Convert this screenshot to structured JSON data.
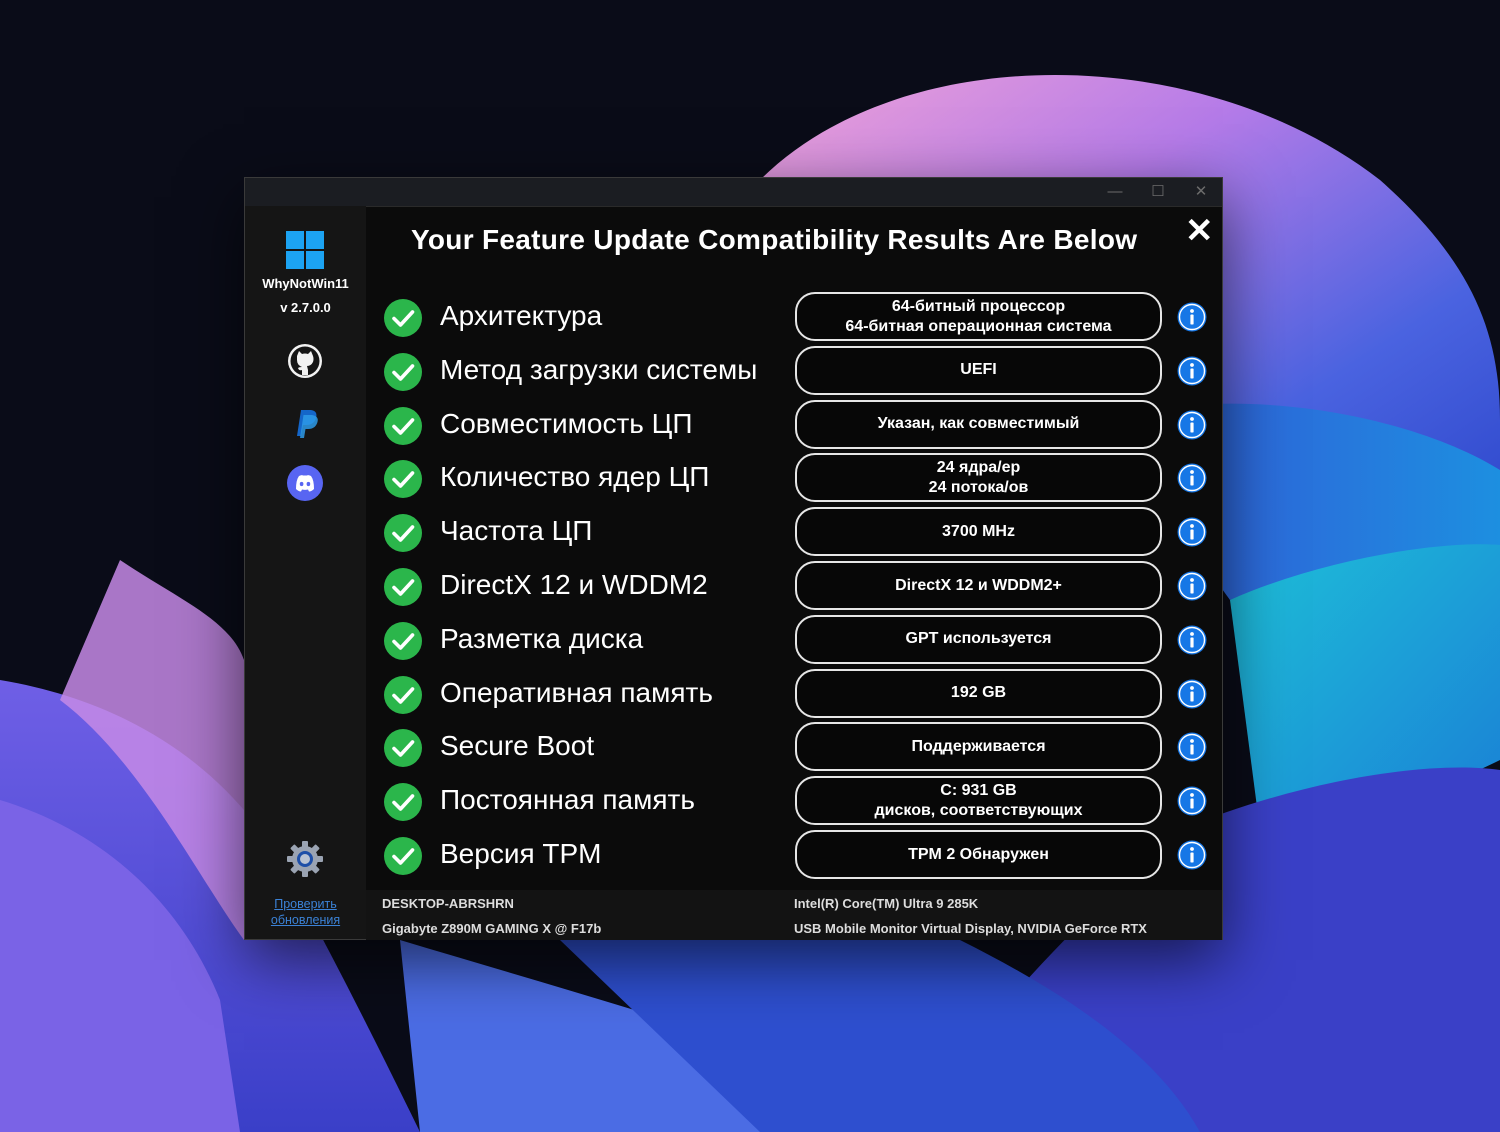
{
  "window": {
    "controls": {
      "minimize": "—",
      "maximize": "☐",
      "close": "✕"
    }
  },
  "sidebar": {
    "app_name": "WhyNotWin11",
    "version": "v 2.7.0.0",
    "icons": [
      "windows-logo-icon",
      "github-icon",
      "paypal-icon",
      "discord-icon",
      "gear-icon"
    ],
    "update_link_line1": "Проверить",
    "update_link_line2": "обновления"
  },
  "main": {
    "title": "Your Feature Update Compatibility Results Are Below",
    "close_label": "✕",
    "checks": [
      {
        "label": "Архитектура",
        "status": "pass",
        "value": [
          "64-битный процессор",
          "64-битная операционная система"
        ]
      },
      {
        "label": "Метод загрузки системы",
        "status": "pass",
        "value": [
          "UEFI"
        ]
      },
      {
        "label": "Совместимость ЦП",
        "status": "pass",
        "value": [
          "Указан, как совместимый"
        ]
      },
      {
        "label": "Количество ядер ЦП",
        "status": "pass",
        "value": [
          "24 ядра/ер",
          "24 потока/ов"
        ]
      },
      {
        "label": "Частота ЦП",
        "status": "pass",
        "value": [
          "3700 MHz"
        ]
      },
      {
        "label": "DirectX 12 и WDDM2",
        "status": "pass",
        "value": [
          "DirectX 12 и WDDM2+"
        ]
      },
      {
        "label": "Разметка диска",
        "status": "pass",
        "value": [
          "GPT используется"
        ]
      },
      {
        "label": "Оперативная память",
        "status": "pass",
        "value": [
          "192 GB"
        ]
      },
      {
        "label": "Secure Boot",
        "status": "pass",
        "value": [
          "Поддерживается"
        ]
      },
      {
        "label": "Постоянная память",
        "status": "pass",
        "value": [
          "C: 931 GB",
          "дисков, соответствующих"
        ]
      },
      {
        "label": "Версия TPM",
        "status": "pass",
        "value": [
          "TPM 2 Обнаружен"
        ]
      }
    ]
  },
  "footer": {
    "hostname": "DESKTOP-ABRSHRN",
    "motherboard": "Gigabyte Z890M GAMING X @ F17b",
    "cpu": "Intel(R) Core(TM) Ultra 9 285K",
    "gpu": "USB Mobile Monitor Virtual Display, NVIDIA GeForce RTX"
  },
  "colors": {
    "accent": "#1ca3f2",
    "check": "#2bb64b",
    "info": "#1677e6",
    "link": "#3b82d6"
  }
}
